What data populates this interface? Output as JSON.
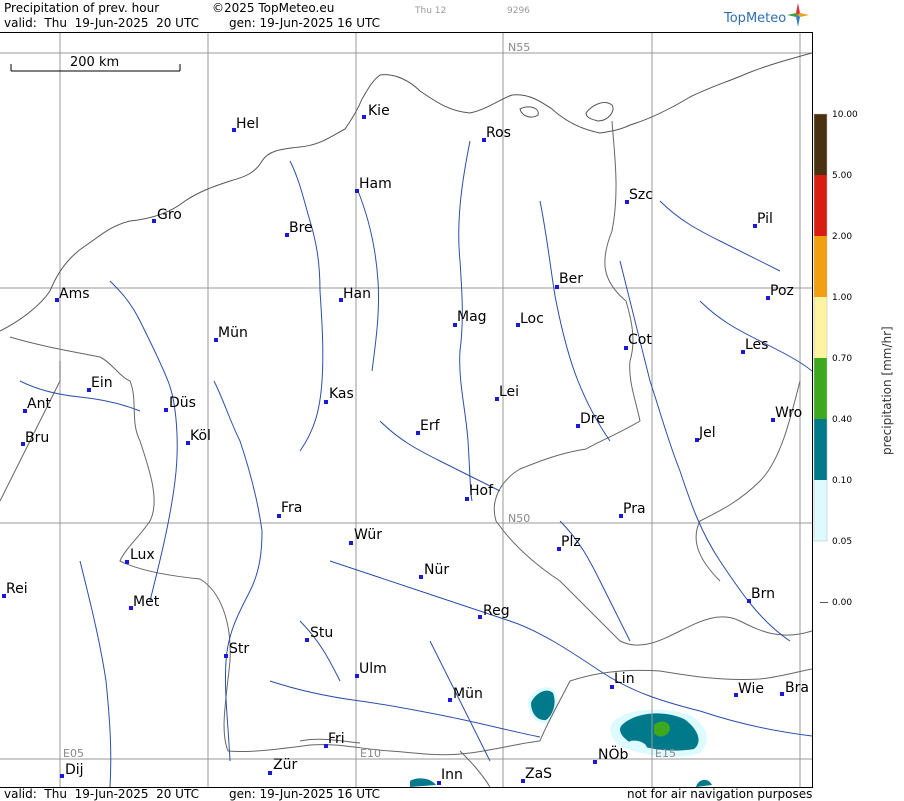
{
  "header": {
    "title": "Precipitation of prev. hour",
    "copyright": "©2025 TopMeteo.eu",
    "day_tag": "Thu 12",
    "code_tag": "9296",
    "valid": "valid:  Thu  19-Jun-2025  20 UTC",
    "gen": "gen: 19-Jun-2025 16 UTC",
    "logo": "TopMeteo"
  },
  "footer": {
    "valid": "valid:  Thu  19-Jun-2025  20 UTC",
    "gen": "gen: 19-Jun-2025 16 UTC",
    "disclaimer": "not for air navigation purposes"
  },
  "map": {
    "scale_label": "200 km",
    "grid_labels": [
      "N55",
      "N50",
      "E05",
      "E10",
      "E15"
    ],
    "cities": [
      "Kie",
      "Hel",
      "Ros",
      "Ham",
      "Szc",
      "Gro",
      "Bre",
      "Pil",
      "Ber",
      "Ams",
      "Han",
      "Poz",
      "Mag",
      "Loc",
      "Mün",
      "Cot",
      "Les",
      "Ein",
      "Kas",
      "Lei",
      "Ant",
      "Düs",
      "Wro",
      "Dre",
      "Erf",
      "Bru",
      "Köl",
      "Jel",
      "Hof",
      "Fra",
      "Pra",
      "Lux",
      "Wür",
      "Plz",
      "Nür",
      "Rei",
      "Met",
      "Brn",
      "Reg",
      "Stu",
      "Str",
      "Ulm",
      "Lin",
      "Wie",
      "Bra",
      "Mün",
      "Fri",
      "NÖb",
      "Dij",
      "Zür",
      "Inn",
      "ZaS"
    ]
  },
  "legend": {
    "axis_label": "precipitation  [mm/hr]",
    "levels": [
      "10.00",
      "5.00",
      "2.00",
      "1.00",
      "0.70",
      "0.40",
      "0.10",
      "0.05",
      "0.00"
    ],
    "colors": [
      "#4a3210",
      "#d81e10",
      "#f2a010",
      "#fdf3a0",
      "#fcffd0",
      "#3ea81e",
      "#007a8a",
      "#ddfaff",
      "#ffffff"
    ]
  }
}
